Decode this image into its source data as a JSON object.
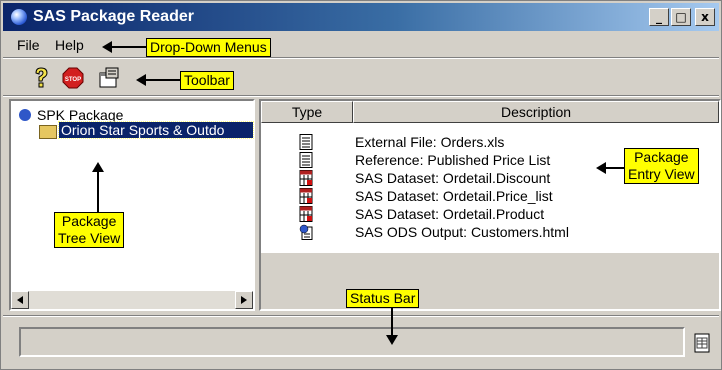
{
  "window": {
    "title": "SAS Package Reader",
    "caption_buttons": {
      "minimize": "_",
      "maximize": "□",
      "close": "x"
    }
  },
  "menu": {
    "items": [
      "File",
      "Help"
    ]
  },
  "callouts": {
    "menus": "Drop-Down Menus",
    "toolbar": "Toolbar",
    "entry_view_line1": "Package",
    "entry_view_line2": "Entry View",
    "tree_view_line1": "Package",
    "tree_view_line2": "Tree View",
    "status_bar": "Status Bar"
  },
  "toolbar": {
    "buttons": [
      {
        "icon": "question-icon"
      },
      {
        "icon": "stop-icon",
        "label": "STOP"
      },
      {
        "icon": "properties-icon"
      }
    ]
  },
  "tree": {
    "root": {
      "label": "SPK Package",
      "icon": "globe-icon"
    },
    "child": {
      "label": "Orion Star Sports & Outdo",
      "icon": "folder-icon",
      "selected": true
    }
  },
  "list": {
    "columns": [
      "Type",
      "Description"
    ],
    "entries": [
      {
        "type_icon": "text-file-icon",
        "description": "External File: Orders.xls"
      },
      {
        "type_icon": "text-file-icon",
        "description": "Reference: Published Price List"
      },
      {
        "type_icon": "sas-dataset-icon",
        "description": "SAS Dataset: Ordetail.Discount"
      },
      {
        "type_icon": "sas-dataset-icon",
        "description": "SAS Dataset: Ordetail.Price_list"
      },
      {
        "type_icon": "sas-dataset-icon",
        "description": "SAS Dataset: Ordetail.Product"
      },
      {
        "type_icon": "ods-output-icon",
        "description": "SAS ODS Output: Customers.html"
      }
    ]
  },
  "status": {
    "text": "",
    "icon": "document-icon"
  },
  "colors": {
    "titlebar_start": "#0a246a",
    "titlebar_end": "#a6caf0",
    "callout_bg": "#ffff00",
    "window_bg": "#d4d0c8",
    "selection": "#0a246a"
  }
}
